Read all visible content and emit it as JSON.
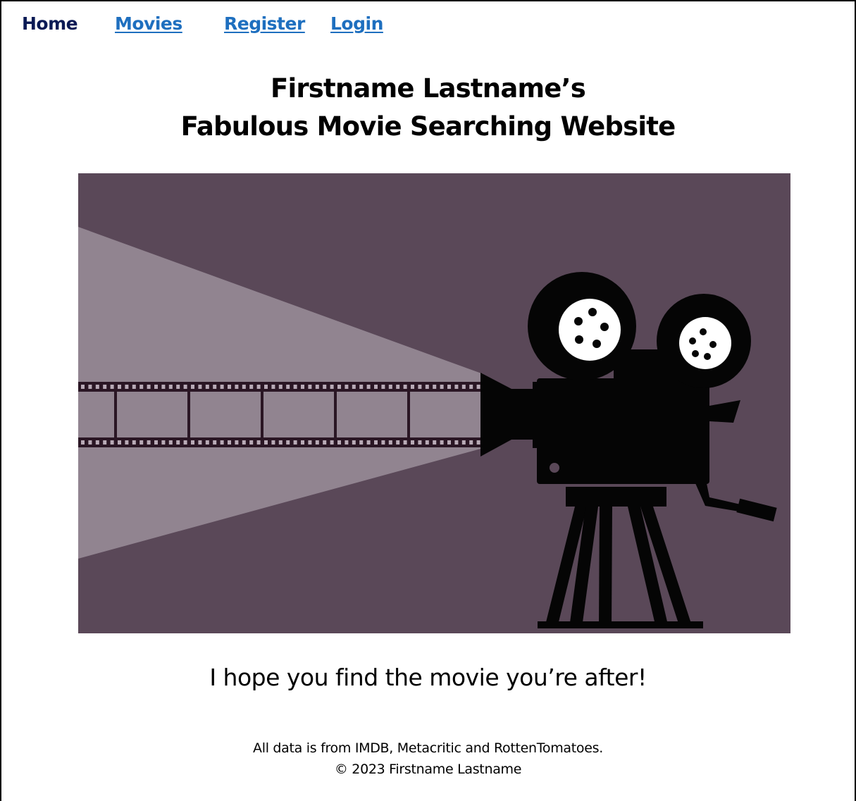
{
  "nav": {
    "home_label": "Home",
    "movies_label": "Movies",
    "register_label": "Register",
    "login_label": "Login"
  },
  "header": {
    "title_line1": "Firstname Lastname’s",
    "title_line2": "Fabulous Movie Searching Website"
  },
  "hero": {
    "icon": "movie-camera-projector-icon",
    "background_color": "#5a4858",
    "beam_color": "#918490"
  },
  "tagline": "I hope you find the movie you’re after!",
  "footer": {
    "sources": "All data is from IMDB, Metacritic and RottenTomatoes.",
    "copyright": "© 2023 Firstname Lastname"
  },
  "colors": {
    "nav_active": "#0a1a55",
    "nav_link": "#1e6fbf"
  }
}
